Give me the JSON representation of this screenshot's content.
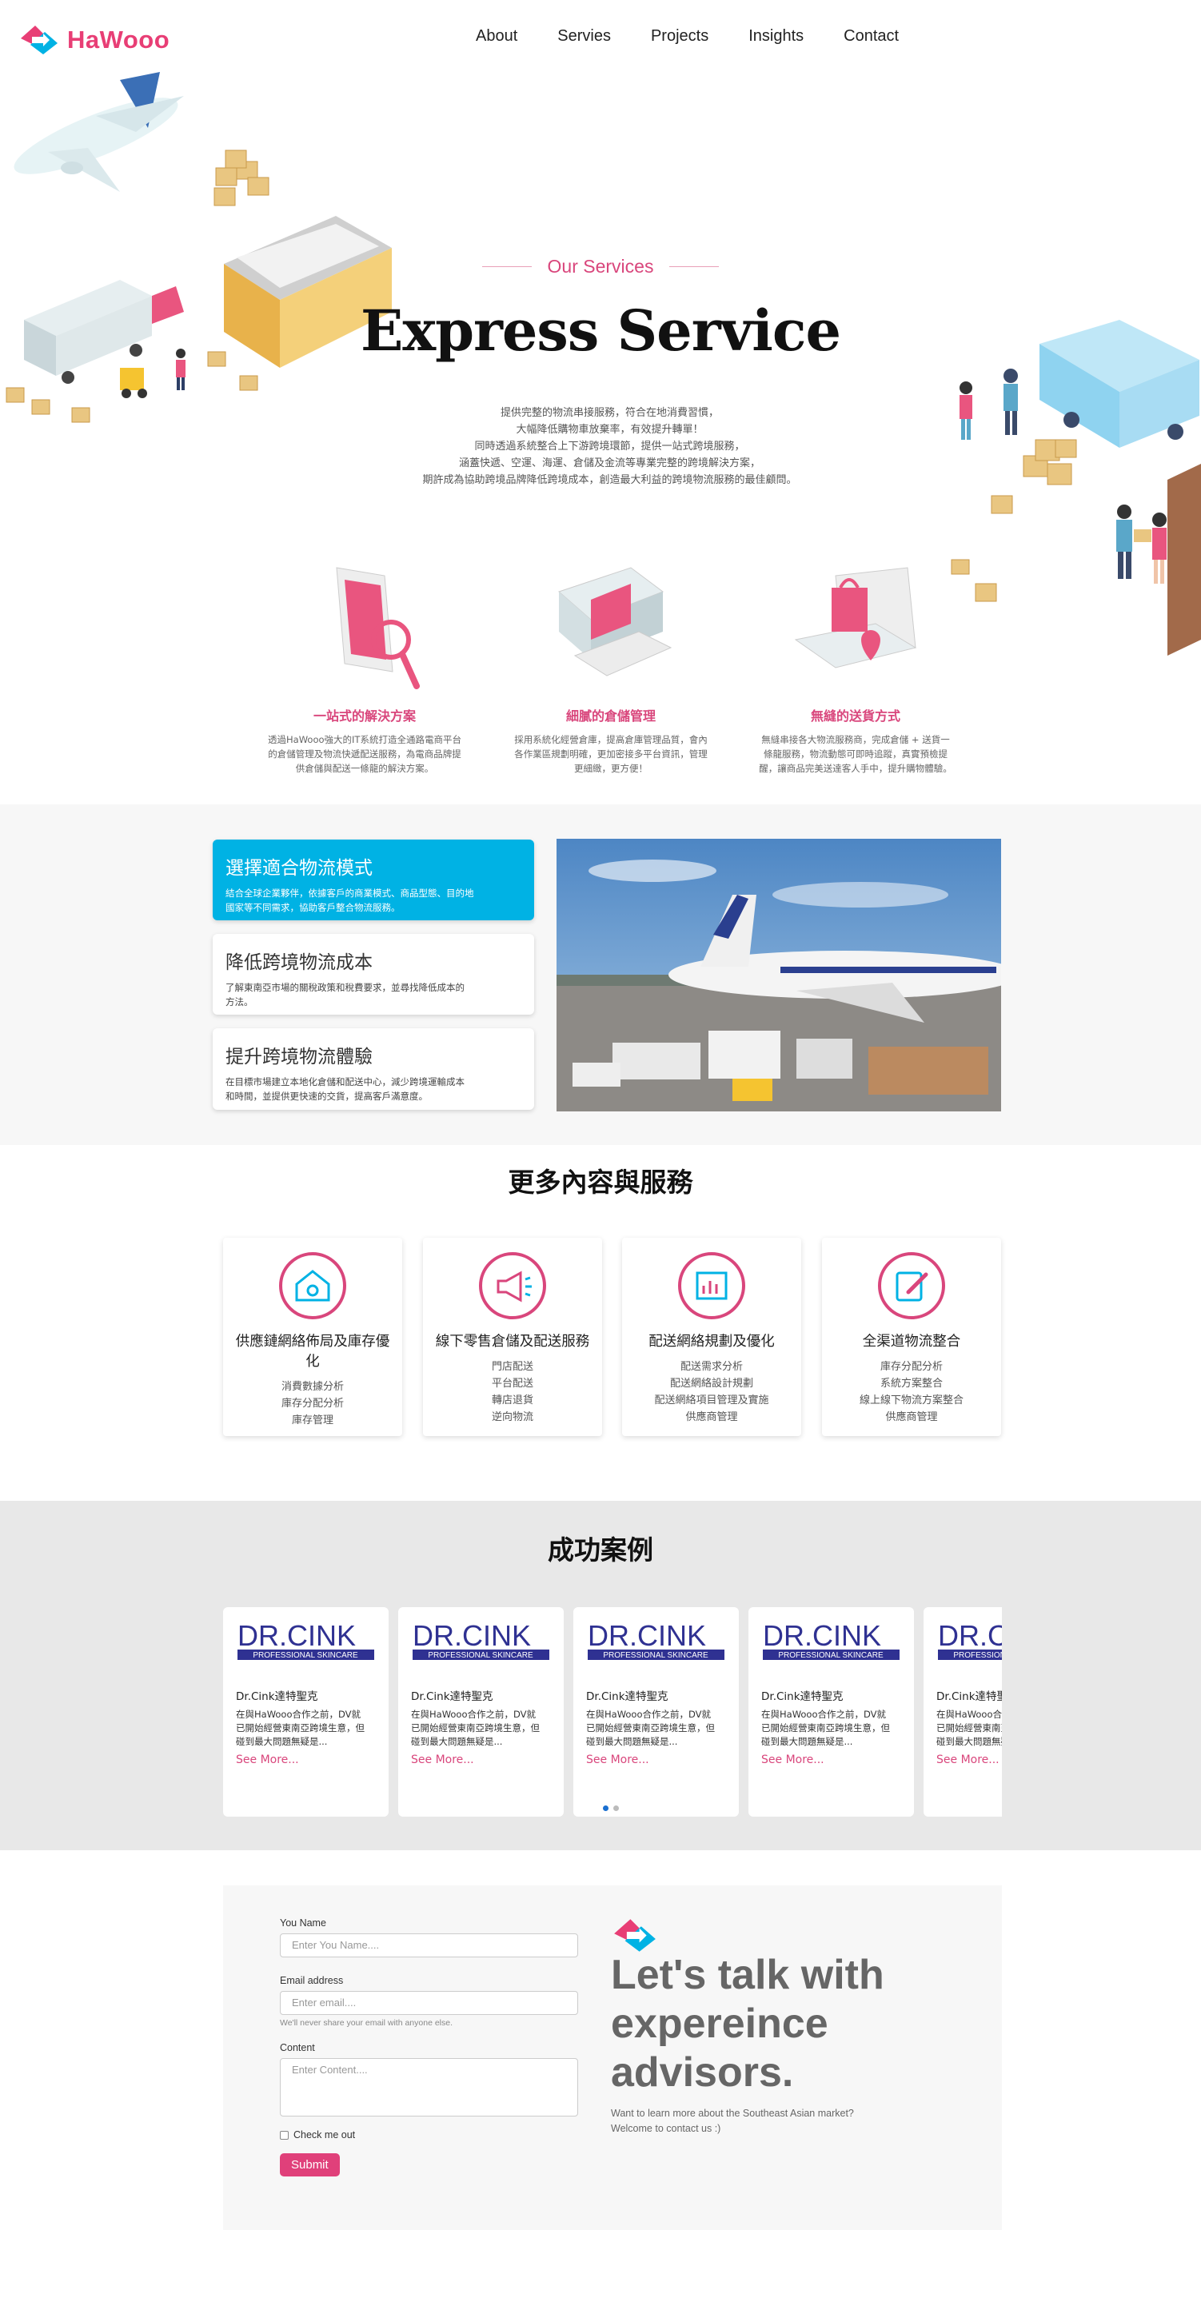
{
  "brand": {
    "name": "HaWooo",
    "pink": "#e83e75",
    "cyan": "#00b2e4"
  },
  "nav": {
    "items": [
      "About",
      "Servies",
      "Projects",
      "Insights",
      "Contact"
    ]
  },
  "hero": {
    "eyebrow": "Our Services",
    "title": "Express Service",
    "desc": [
      "提供完整的物流串接服務，符合在地消費習慣，",
      "大幅降低購物車放棄率，有效提升轉單！",
      "同時透過系統整合上下游跨境環節，提供一站式跨境服務，",
      "涵蓋快遞、空運、海運、倉儲及金流等專業完整的跨境解決方案，",
      "期許成為協助跨境品牌降低跨境成本，創造最大利益的跨境物流服務的最佳顧問。"
    ]
  },
  "features": [
    {
      "title": "一站式的解決方案",
      "lines": [
        "透過HaWooo強大的IT系統打造全通路電商平台",
        "的倉儲管理及物流快遞配送服務，為電商品牌提",
        "供倉儲與配送一條龍的解決方案。"
      ]
    },
    {
      "title": "細膩的倉儲管理",
      "lines": [
        "採用系統化經營倉庫，提高倉庫管理品質，會內",
        "各作業區規劃明確，更加密接多平台資訊，管理",
        "更細緻，更方便！"
      ]
    },
    {
      "title": "無縫的送貨方式",
      "lines": [
        "無縫串接各大物流服務商，完成倉儲 + 送貨一",
        "條龍服務，物流動態可即時追蹤，真實預檢提",
        "醒，讓商品完美送達客人手中，提升購物體驗。"
      ]
    }
  ],
  "tabs": [
    {
      "title": "選擇適合物流模式",
      "lines": [
        "結合全球企業夥伴，依據客戶的商業模式、商品型態、目的地",
        "國家等不同需求，協助客戶整合物流服務。"
      ],
      "active": true
    },
    {
      "title": "降低跨境物流成本",
      "lines": [
        "了解東南亞市場的關稅政策和稅費要求，並尋找降低成本的",
        "方法。"
      ],
      "active": false
    },
    {
      "title": "提升跨境物流體驗",
      "lines": [
        "在目標市場建立本地化倉儲和配送中心，減少跨境運輸成本",
        "和時間，並提供更快速的交貨，提高客戶滿意度。"
      ],
      "active": false
    }
  ],
  "more": {
    "title": "更多內容與服務",
    "cards": [
      {
        "icon": "warehouse-icon",
        "title": "供應鏈網絡佈局及庫存優化",
        "items": [
          "消費數據分析",
          "庫存分配分析",
          "庫存管理"
        ]
      },
      {
        "icon": "megaphone-icon",
        "title": "線下零售倉儲及配送服務",
        "items": [
          "門店配送",
          "平台配送",
          "轉店退貨",
          "逆向物流"
        ]
      },
      {
        "icon": "chart-icon",
        "title": "配送網絡規劃及優化",
        "items": [
          "配送需求分析",
          "配送網絡設計規劃",
          "配送網絡項目管理及實施",
          "供應商管理"
        ]
      },
      {
        "icon": "edit-icon",
        "title": "全渠道物流整合",
        "items": [
          "庫存分配分析",
          "系統方案整合",
          "線上線下物流方案整合",
          "供應商管理"
        ]
      }
    ]
  },
  "cases": {
    "title": "成功案例",
    "logo_main": "DR.CINK",
    "logo_sub": "PROFESSIONAL SKINCARE",
    "items": [
      {
        "title": "Dr.Cink達特聖克",
        "lines": [
          "在與HaWooo合作之前，DV就",
          "已開始經營東南亞跨境生意，但",
          "碰到最大問題無疑是..."
        ],
        "link": "See More..."
      },
      {
        "title": "Dr.Cink達特聖克",
        "lines": [
          "在與HaWooo合作之前，DV就",
          "已開始經營東南亞跨境生意，但",
          "碰到最大問題無疑是..."
        ],
        "link": "See More..."
      },
      {
        "title": "Dr.Cink達特聖克",
        "lines": [
          "在與HaWooo合作之前，DV就",
          "已開始經營東南亞跨境生意，但",
          "碰到最大問題無疑是..."
        ],
        "link": "See More..."
      },
      {
        "title": "Dr.Cink達特聖克",
        "lines": [
          "在與HaWooo合作之前，DV就",
          "已開始經營東南亞跨境生意，但",
          "碰到最大問題無疑是..."
        ],
        "link": "See More..."
      },
      {
        "title": "Dr.Cink達特聖克",
        "lines": [
          "在與HaWooo合作之前，DV就",
          "已開始經營東南亞跨境生意，但",
          "碰到最大問題無疑是..."
        ],
        "link": "See More..."
      }
    ]
  },
  "contact": {
    "name_label": "You Name",
    "name_placeholder": "Enter You Name....",
    "email_label": "Email address",
    "email_placeholder": "Enter email....",
    "email_help": "We'll never share your email with anyone else.",
    "content_label": "Content",
    "content_placeholder": "Enter Content....",
    "check_label": "Check me out",
    "submit_label": "Submit",
    "talk_title_lines": [
      "Let's talk with",
      "expereince",
      "advisors."
    ],
    "talk_sub_lines": [
      "Want to learn more about the Southeast Asian market?",
      "Welcome to contact us :)"
    ]
  }
}
